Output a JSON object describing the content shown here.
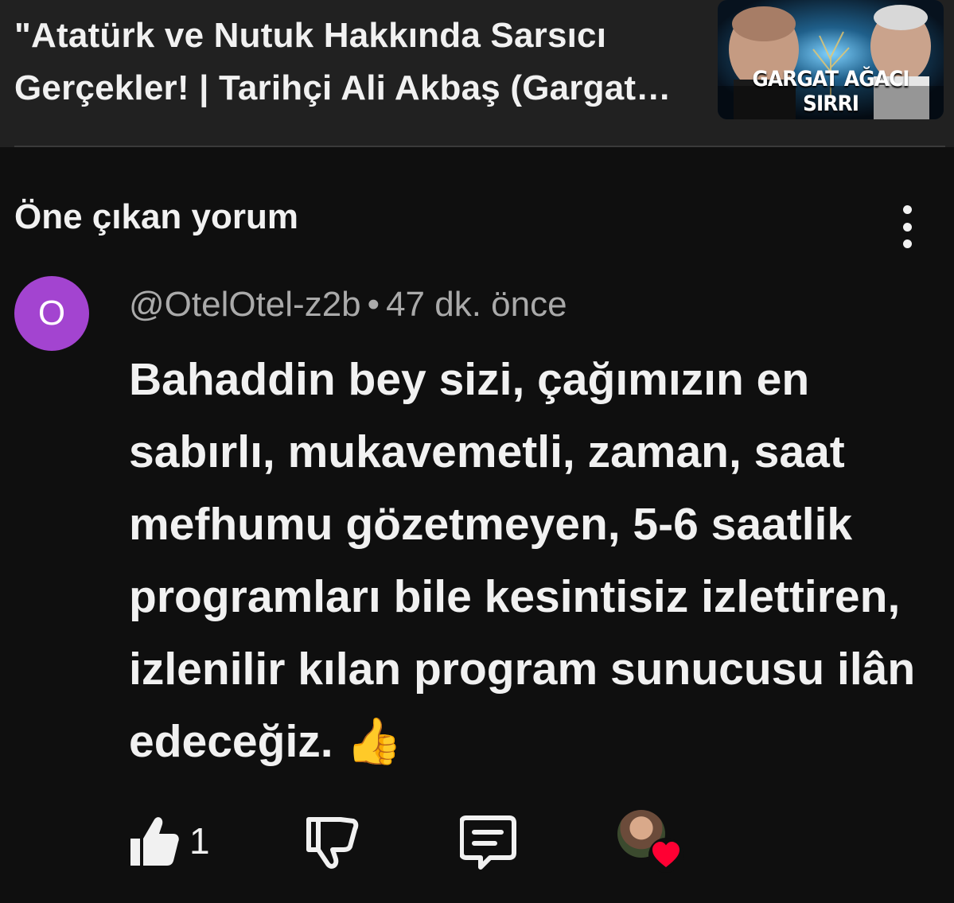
{
  "video": {
    "title": "\"Atatürk ve Nutuk Hakkında Sarsıcı Gerçekler! | Tarihçi Ali Akbaş (Gargat Ağacı Sırrı)",
    "thumbnail_caption": "GARGAT AĞACI SIRRI"
  },
  "section": {
    "title": "Öne çıkan yorum",
    "more_icon": "vertical-ellipsis-icon"
  },
  "comment": {
    "avatar_letter": "O",
    "avatar_color": "#a344d0",
    "author": "@OtelOtel-z2b",
    "separator": "•",
    "time": "47 dk. önce",
    "text": "Bahaddin bey sizi, çağımızın en sabırlı, mukavemetli, zaman, saat mefhumu gözetmeyen, 5-6 saatlik programları bile kesintisiz izlettiren, izlenilir kılan program sunucusu ilân edeceğiz.",
    "emoji": "👍",
    "like_count": "1"
  },
  "actions": {
    "like_icon": "thumbs-up-icon",
    "dislike_icon": "thumbs-down-icon",
    "reply_icon": "reply-icon",
    "creator_heart_icon": "creator-heart-icon",
    "heart_color": "#ff0033"
  }
}
